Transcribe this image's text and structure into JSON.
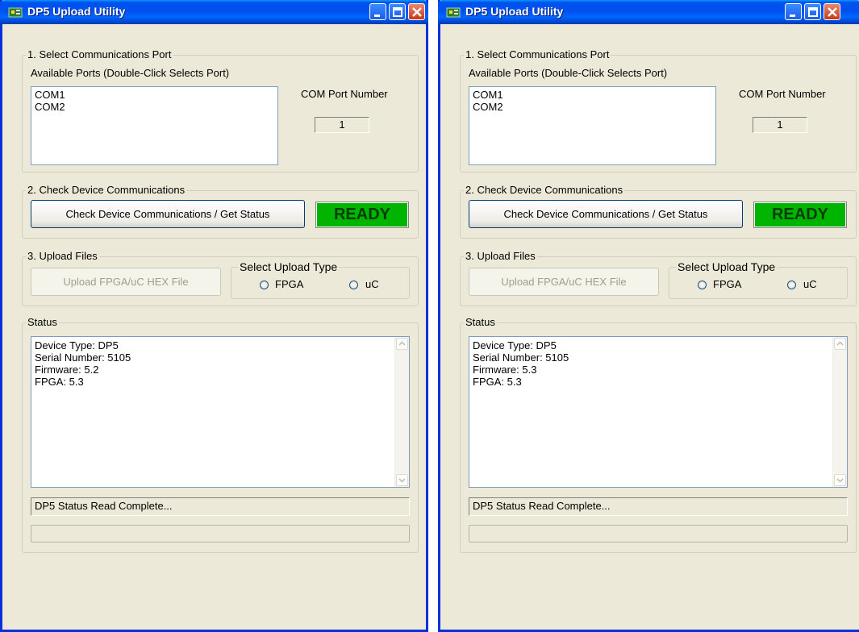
{
  "windows": [
    {
      "title": "DP5 Upload Utility",
      "section1": {
        "label": "1. Select Communications Port",
        "ports_label": "Available Ports (Double-Click Selects Port)",
        "ports": [
          "COM1",
          "COM2"
        ],
        "com_port_label": "COM Port Number",
        "com_port_value": "1"
      },
      "section2": {
        "label": "2. Check Device Communications",
        "check_button": "Check Device Communications / Get Status",
        "ready_text": "READY"
      },
      "section3": {
        "label": "3. Upload Files",
        "upload_button": "Upload FPGA/uC HEX File",
        "upload_type_label": "Select Upload Type",
        "option_fpga": "FPGA",
        "option_uc": "uC"
      },
      "status": {
        "label": "Status",
        "lines": [
          "Device Type: DP5",
          "Serial Number: 5105",
          "Firmware: 5.2",
          "FPGA: 5.3"
        ],
        "message": "DP5 Status Read Complete..."
      }
    },
    {
      "title": "DP5 Upload Utility",
      "section1": {
        "label": "1. Select Communications Port",
        "ports_label": "Available Ports (Double-Click Selects Port)",
        "ports": [
          "COM1",
          "COM2"
        ],
        "com_port_label": "COM Port Number",
        "com_port_value": "1"
      },
      "section2": {
        "label": "2. Check Device Communications",
        "check_button": "Check Device Communications / Get Status",
        "ready_text": "READY"
      },
      "section3": {
        "label": "3. Upload Files",
        "upload_button": "Upload FPGA/uC HEX File",
        "upload_type_label": "Select Upload Type",
        "option_fpga": "FPGA",
        "option_uc": "uC"
      },
      "status": {
        "label": "Status",
        "lines": [
          "Device Type: DP5",
          "Serial Number: 5105",
          "Firmware: 5.3",
          "FPGA: 5.3"
        ],
        "message": "DP5 Status Read Complete..."
      }
    }
  ],
  "colors": {
    "titlebar": "#0054e3",
    "window_bg": "#ece9d8",
    "ready_bg": "#00b400",
    "ready_text": "#003c00"
  },
  "icons": [
    "app-board-icon",
    "minimize-icon",
    "maximize-icon",
    "close-icon",
    "scroll-up-icon",
    "scroll-down-icon"
  ]
}
